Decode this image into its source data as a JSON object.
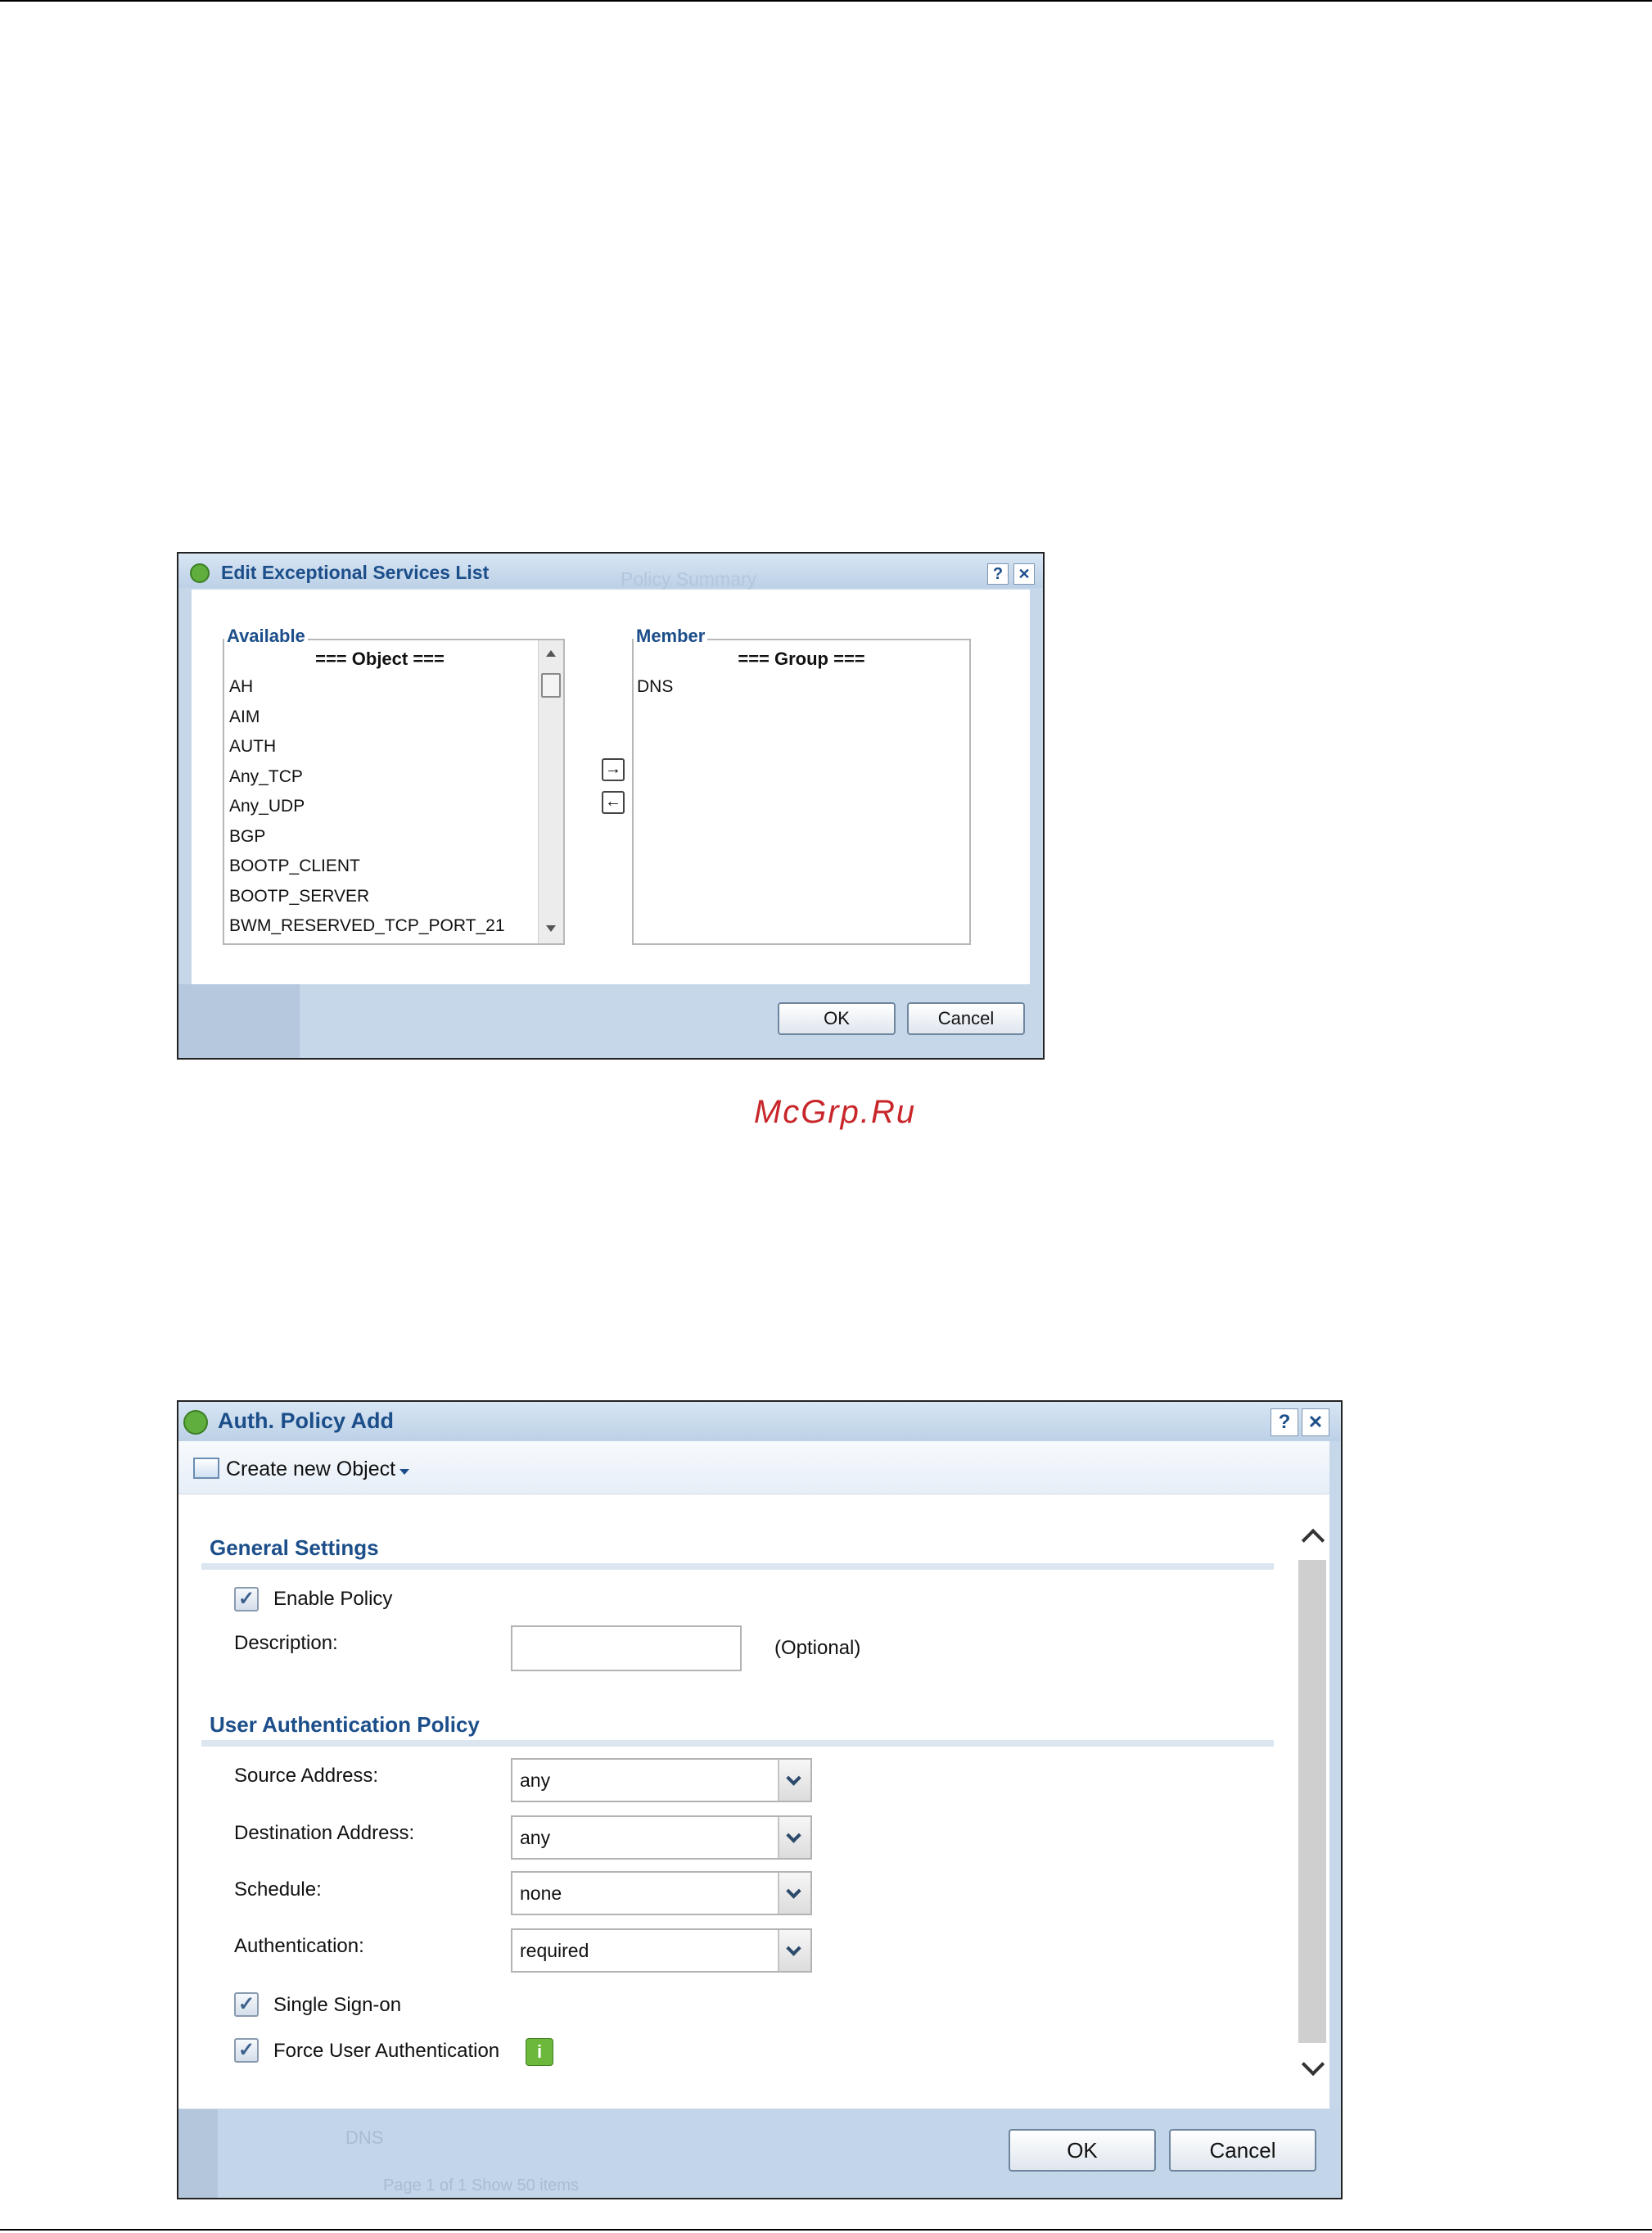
{
  "dialog1": {
    "title": "Edit Exceptional Services List",
    "title_ghost": "Policy Summary",
    "help_label": "?",
    "close_label": "✕",
    "available": {
      "legend": "Available",
      "header": "=== Object ===",
      "items": [
        "AH",
        "AIM",
        "AUTH",
        "Any_TCP",
        "Any_UDP",
        "BGP",
        "BOOTP_CLIENT",
        "BOOTP_SERVER",
        "BWM_RESERVED_TCP_PORT_21"
      ]
    },
    "member": {
      "legend": "Member",
      "header": "=== Group ===",
      "items": [
        "DNS"
      ]
    },
    "add_label": "→",
    "remove_label": "←",
    "ok_label": "OK",
    "cancel_label": "Cancel"
  },
  "watermark": "McGrp.Ru",
  "dialog2": {
    "title": "Auth. Policy Add",
    "help_label": "?",
    "close_label": "✕",
    "create_label": "Create new Object",
    "general": {
      "heading": "General Settings",
      "enable_label": "Enable Policy",
      "enable_checked": true,
      "description_label": "Description:",
      "description_value": "",
      "optional_label": "(Optional)"
    },
    "uap": {
      "heading": "User Authentication Policy",
      "source_label": "Source Address:",
      "source_value": "any",
      "dest_label": "Destination Address:",
      "dest_value": "any",
      "schedule_label": "Schedule:",
      "schedule_value": "none",
      "auth_label": "Authentication:",
      "auth_value": "required",
      "sso_label": "Single Sign-on",
      "sso_checked": true,
      "force_label": "Force User Authentication",
      "force_checked": true,
      "info_label": "i"
    },
    "ok_label": "OK",
    "cancel_label": "Cancel",
    "ghost_dns": "DNS",
    "ghost_pager": "Page 1 of 1   Show 50 items"
  }
}
